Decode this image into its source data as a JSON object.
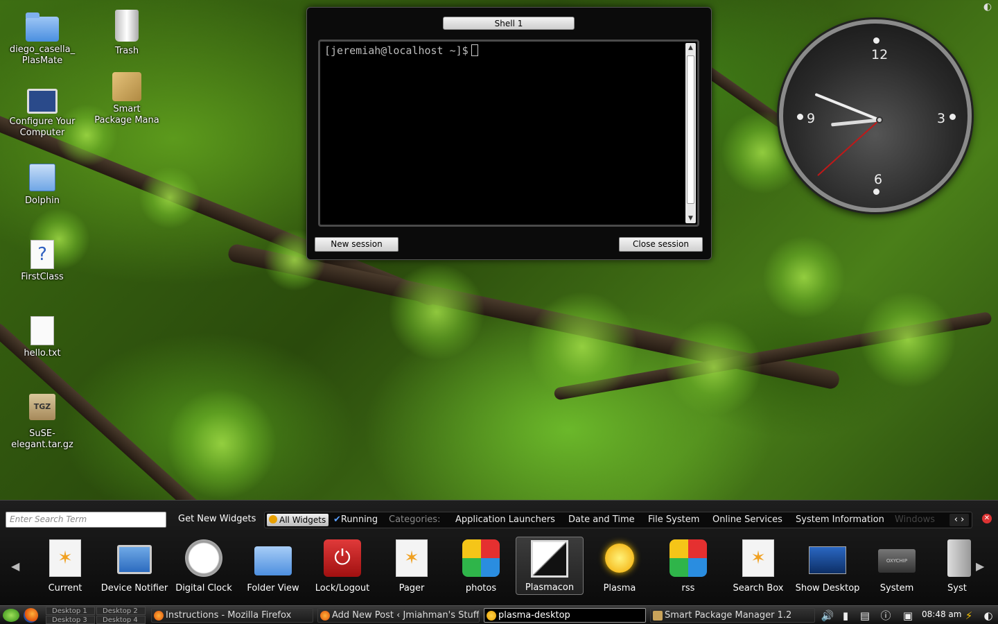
{
  "desktop": {
    "icons": [
      {
        "label": "diego_casella_\nPlasMate",
        "line1": "diego_casella_",
        "line2": "PlasMate"
      },
      {
        "label": "Trash"
      },
      {
        "line1": "Configure Your",
        "line2": "Computer"
      },
      {
        "line1": "Smart",
        "line2": "Package Mana"
      },
      {
        "label": "Dolphin"
      },
      {
        "label": "FirstClass"
      },
      {
        "label": "hello.txt"
      },
      {
        "line1": "SuSE-",
        "line2": "elegant.tar.gz",
        "badge": "TGZ"
      }
    ]
  },
  "shell": {
    "tab_label": "Shell 1",
    "prompt": "[jeremiah@localhost ~]$",
    "new_session": "New session",
    "close_session": "Close session"
  },
  "clock": {
    "numbers": [
      "12",
      "3",
      "6",
      "9"
    ],
    "time_hours": 8,
    "time_minutes": 48,
    "time_seconds": 38
  },
  "explorer": {
    "search_placeholder": "Enter Search Term",
    "get_new_widgets": "Get New Widgets",
    "filters": {
      "all_widgets": "All Widgets",
      "running": "Running",
      "categories_label": "Categories:",
      "categories": [
        "Application Launchers",
        "Date and Time",
        "File System",
        "Online Services",
        "System Information",
        "Windows"
      ]
    },
    "widgets": [
      {
        "label": "Current",
        "icon": "star-doc-icon"
      },
      {
        "label": "Device Notifier",
        "icon": "usb-monitor-icon"
      },
      {
        "label": "Digital Clock",
        "icon": "alarm-clock-icon"
      },
      {
        "label": "Folder View",
        "icon": "folder-icon"
      },
      {
        "label": "Lock/Logout",
        "icon": "power-icon"
      },
      {
        "label": "Pager",
        "icon": "star-doc-icon"
      },
      {
        "label": "photos",
        "icon": "photos-icon"
      },
      {
        "label": "Plasmacon",
        "icon": "plasmacon-icon"
      },
      {
        "label": "Plasma",
        "icon": "sun-icon"
      },
      {
        "label": "rss",
        "icon": "photos-icon"
      },
      {
        "label": "Search Box",
        "icon": "star-doc-icon"
      },
      {
        "label": "Show Desktop",
        "icon": "desktop-icon"
      },
      {
        "label": "System",
        "icon": "chip-icon"
      },
      {
        "label": "Syst",
        "icon": "hdd-icon"
      }
    ],
    "chip_text": "OXYCHIP"
  },
  "panel": {
    "pager": [
      "Desktop 1",
      "Desktop 2",
      "Desktop 3",
      "Desktop 4"
    ],
    "tasks": [
      "Instructions - Mozilla Firefox",
      "Add New Post ‹ Jmiahman's Stuff",
      "plasma-desktop",
      "Smart Package Manager 1.2"
    ],
    "time": "08:48 am"
  },
  "colors": {
    "accent_red": "#d33333",
    "terminal_bg": "#000000",
    "panel_bg": "#1b1b1b"
  }
}
